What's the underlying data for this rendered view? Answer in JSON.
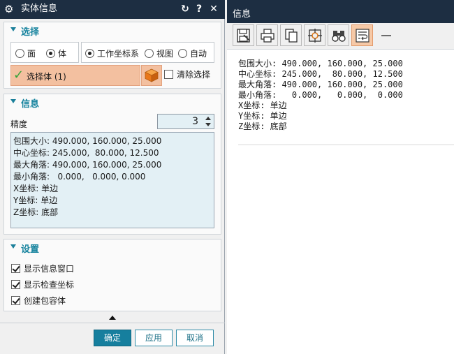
{
  "dialog": {
    "title": "实体信息",
    "sections": {
      "select": {
        "title": "选择",
        "radio_face": "面",
        "radio_body": "体",
        "radio_wcs": "工作坐标系",
        "radio_view": "视图",
        "radio_auto": "自动",
        "selection_label": "选择体 (1)",
        "clear_selection": "清除选择"
      },
      "info": {
        "title": "信息",
        "precision_label": "精度",
        "precision_value": "3",
        "lines": [
          "包围大小: 490.000, 160.000, 25.000",
          "中心坐标: 245.000,  80.000, 12.500",
          "最大角落: 490.000, 160.000, 25.000",
          "最小角落:   0.000,   0.000, 0.000",
          "X坐标: 单边",
          "Y坐标: 单边",
          "Z坐标: 底部"
        ]
      },
      "settings": {
        "title": "设置",
        "show_info_window": "显示信息窗口",
        "show_check_coords": "显示检查坐标",
        "create_bounding_body": "创建包容体"
      }
    },
    "buttons": {
      "ok": "确定",
      "apply": "应用",
      "cancel": "取消"
    }
  },
  "info_window": {
    "title": "信息",
    "lines": [
      "包围大小: 490.000, 160.000, 25.000",
      "中心坐标: 245.000,  80.000, 12.500",
      "最大角落: 490.000, 160.000, 25.000",
      "最小角落:   0.000,   0.000,  0.000",
      "X坐标: 单边",
      "Y坐标: 单边",
      "Z坐标: 底部"
    ]
  },
  "colors": {
    "titlebar": "#1d2e42",
    "accent": "#16839e",
    "selection": "#f3c0a0",
    "cube": "#f08a24"
  }
}
